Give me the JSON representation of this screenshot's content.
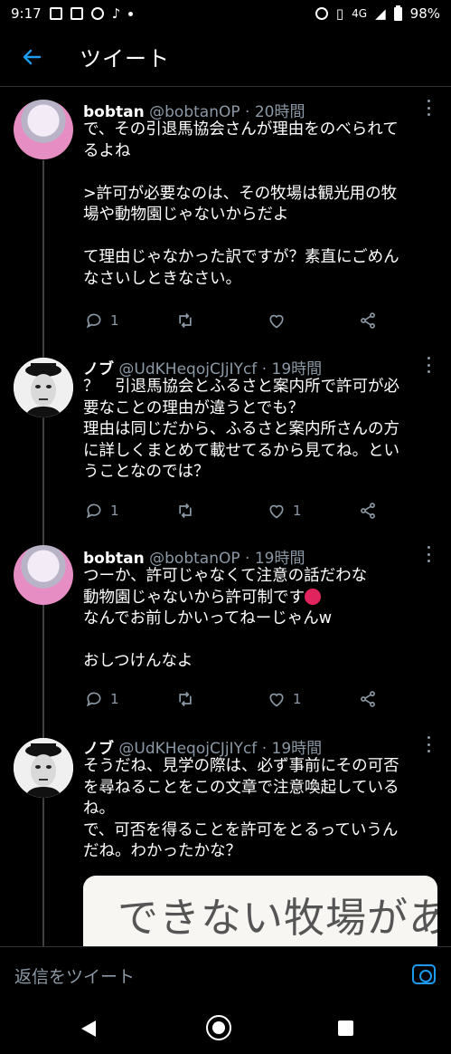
{
  "status_bar": {
    "time": "9:17",
    "network": "4G",
    "battery": "98%"
  },
  "header": {
    "title": "ツイート"
  },
  "tweets": [
    {
      "name": "bobtan",
      "handle": "@bobtanOP",
      "time": "· 20時間",
      "text": "で、その引退馬協会さんが理由をのべられて\nるよね\n\n>許可が必要なのは、その牧場は観光用の牧\n場や動物園じゃないからだよ\n\nて理由じゃなかった訳ですが？素直にごめん\nなさいしときなさい。",
      "replies": "1",
      "retweets": "",
      "likes": ""
    },
    {
      "name": "ノブ",
      "handle": "@UdKHeqojCJjIYcf",
      "time": "· 19時間",
      "text": "？　引退馬協会とふるさと案内所で許可が必\n要なことの理由が違うとでも？\n理由は同じだから、ふるさと案内所さんの方\nに詳しくまとめて載せてるから見てね。とい\nうことなのでは？",
      "replies": "1",
      "retweets": "",
      "likes": "1"
    },
    {
      "name": "bobtan",
      "handle": "@bobtanOP",
      "time": "· 19時間",
      "text_line1": "つーか、許可じゃなくて注意の話だわな",
      "text_line2": "動物園じゃないから許可制です",
      "text_rest": "なんでお前しかいってねーじゃんw\n\nおしつけんなよ",
      "replies": "1",
      "retweets": "",
      "likes": "1"
    },
    {
      "name": "ノブ",
      "handle": "@UdKHeqojCJjIYcf",
      "time": "· 19時間",
      "text": "そうだね、見学の際は、必ず事前にその可否\nを尋ねることをこの文章で注意喚起している\nね。\nで、可否を得ることを許可をとるっていうん\nだね。わかったかな？",
      "image_text": "できない牧場があ"
    }
  ],
  "reply_bar": {
    "placeholder": "返信をツイート"
  },
  "colors": {
    "background": "#000000",
    "accent": "#1d9bf0",
    "secondary_text": "#8b98a5"
  }
}
